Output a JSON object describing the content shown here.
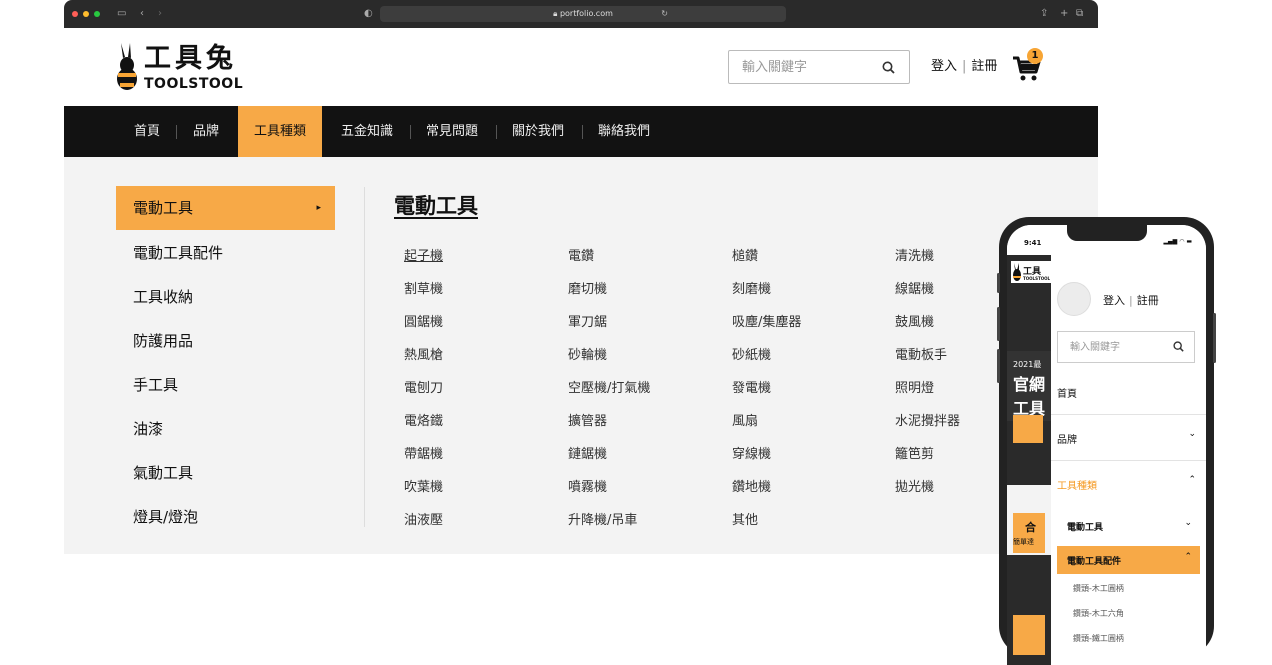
{
  "browser": {
    "url": "portfolio.com",
    "colors": {
      "traffic": [
        "#ff5f57",
        "#febc2e",
        "#28c840"
      ]
    }
  },
  "header": {
    "logo_cn": "工具兔",
    "logo_en": "TOOLSTOOL",
    "search_placeholder": "輸入關鍵字",
    "login": "登入",
    "register": "註冊",
    "cart_count": "1"
  },
  "nav": {
    "items": [
      {
        "label": "首頁"
      },
      {
        "label": "品牌"
      },
      {
        "label": "工具種類",
        "active": true
      },
      {
        "label": "五金知識"
      },
      {
        "label": "常見問題"
      },
      {
        "label": "關於我們"
      },
      {
        "label": "聯絡我們"
      }
    ]
  },
  "categories": {
    "items": [
      {
        "label": "電動工具",
        "active": true
      },
      {
        "label": "電動工具配件"
      },
      {
        "label": "工具收納"
      },
      {
        "label": "防護用品"
      },
      {
        "label": "手工具"
      },
      {
        "label": "油漆"
      },
      {
        "label": "氣動工具"
      },
      {
        "label": "燈具/燈泡"
      }
    ],
    "arrow": "▸"
  },
  "subcategory": {
    "title": "電動工具",
    "items": [
      "起子機",
      "電鑽",
      "槌鑽",
      "清洗機",
      "割草機",
      "磨切機",
      "刻磨機",
      "線鋸機",
      "圓鋸機",
      "軍刀鋸",
      "吸塵/集塵器",
      "鼓風機",
      "熱風槍",
      "砂輪機",
      "砂紙機",
      "電動板手",
      "電刨刀",
      "空壓機/打氣機",
      "發電機",
      "照明燈",
      "電烙鐵",
      "擴管器",
      "風扇",
      "水泥攪拌器",
      "帶鋸機",
      "鏈鋸機",
      "穿線機",
      "籬笆剪",
      "吹葉機",
      "噴霧機",
      "鑽地機",
      "拋光機",
      "油液壓",
      "升降機/吊車",
      "其他"
    ]
  },
  "phone": {
    "time": "9:41",
    "background_text": {
      "year": "2021最",
      "line1": "官網",
      "line2": "工具",
      "promo1": "合",
      "promo2": "簡單達"
    },
    "drawer": {
      "login": "登入",
      "register": "註冊",
      "search_placeholder": "輸入關鍵字",
      "nav": [
        {
          "label": "首頁"
        },
        {
          "label": "品牌",
          "chevron": "⌄"
        },
        {
          "label": "工具種類",
          "chevron": "⌃",
          "open": true
        }
      ],
      "subs": [
        {
          "label": "電動工具",
          "chevron": "⌄"
        },
        {
          "label": "電動工具配件",
          "chevron": "⌃",
          "active": true
        }
      ],
      "leaves": [
        "鑽頭-木工圓柄",
        "鑽頭-木工六角",
        "鑽頭-鐵工圓柄"
      ]
    }
  },
  "colors": {
    "accent": "#f7a947",
    "nav_bg": "#121212",
    "menu_bg": "#f3f3f3"
  }
}
